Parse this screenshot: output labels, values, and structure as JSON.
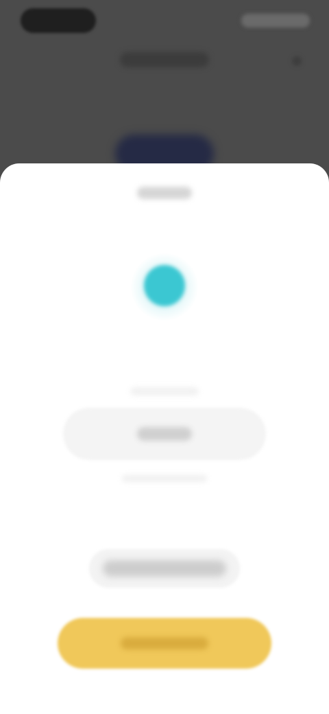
{
  "status_bar": {
    "time": "",
    "icons": [
      "signal-icon",
      "wifi-icon",
      "battery-icon"
    ]
  },
  "header": {
    "title": ""
  },
  "sheet": {
    "title": "",
    "status_indicator": {
      "color": "#3bc7d2"
    },
    "input": {
      "value": "",
      "hint_above": "",
      "hint_below": ""
    },
    "secondary_button": {
      "label": ""
    },
    "primary_button": {
      "label": "",
      "color": "#f0c85a"
    }
  }
}
